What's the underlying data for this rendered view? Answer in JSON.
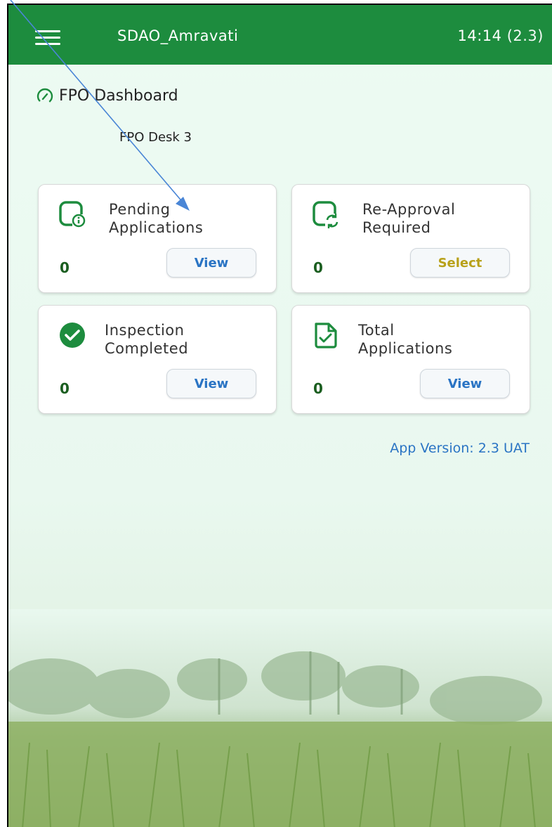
{
  "appbar": {
    "title": "SDAO_Amravati",
    "time": "14:14",
    "version_badge": "(2.3)",
    "menu_icon": "hamburger-menu-icon",
    "color": "#1d8c3e"
  },
  "dashboard": {
    "title": "FPO Dashboard",
    "title_icon": "speedometer-icon",
    "subtitle": "FPO Desk 3"
  },
  "cards": [
    {
      "label_line1": "Pending",
      "label_line2": "Applications",
      "icon": "document-info-icon",
      "count": "0",
      "button": "View"
    },
    {
      "label_line1": "Re-Approval",
      "label_line2": "Required",
      "icon": "document-refresh-icon",
      "count": "0",
      "button": "Select"
    },
    {
      "label_line1": "Inspection",
      "label_line2": "Completed",
      "icon": "check-circle-icon",
      "count": "0",
      "button": "View"
    },
    {
      "label_line1": "Total",
      "label_line2": "Applications",
      "icon": "document-check-icon",
      "count": "0",
      "button": "View"
    }
  ],
  "footer": {
    "app_version": "App Version: 2.3 UAT"
  },
  "colors": {
    "primary_green": "#1d8c3e",
    "link_blue": "#2a74c4",
    "select_gold": "#b8a11a",
    "count_green": "#1b5e20"
  }
}
